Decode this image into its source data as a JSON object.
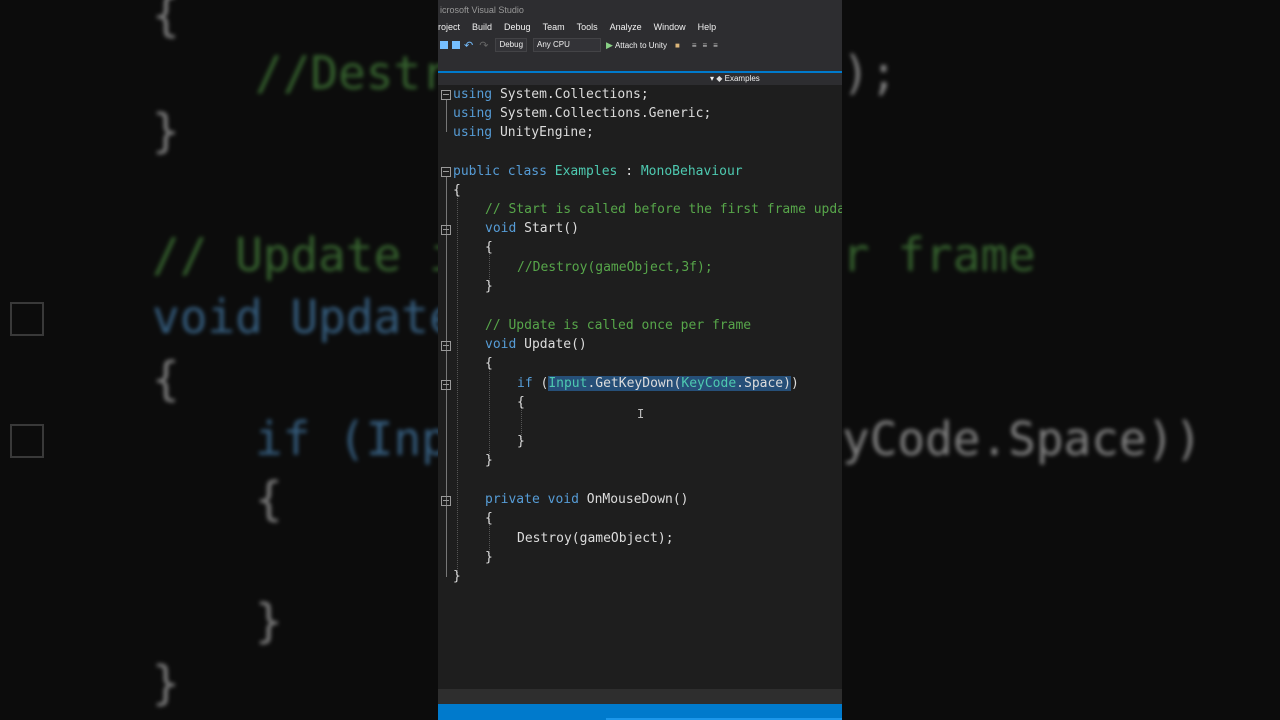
{
  "window": {
    "title": "icrosoft Visual Studio"
  },
  "menu": [
    "roject",
    "Build",
    "Debug",
    "Team",
    "Tools",
    "Analyze",
    "Window",
    "Help"
  ],
  "toolbar": {
    "config": "Debug",
    "platform": "Any CPU",
    "attach": "Attach to Unity"
  },
  "nav": {
    "member": "Examples"
  },
  "code": {
    "l1a": "using",
    "l1b": " System.Collections;",
    "l2a": "using",
    "l2b": " System.Collections.Generic;",
    "l3a": "using",
    "l3b": " UnityEngine;",
    "l5a": "public class",
    "l5b": " ",
    "l5c": "Examples",
    "l5d": " : ",
    "l5e": "MonoBehaviour",
    "l6": "{",
    "l7": "// Start is called before the first frame update",
    "l8a": "void",
    "l8b": " Start()",
    "l9": "{",
    "l10": "//Destroy(gameObject,3f);",
    "l11": "}",
    "l13": "// Update is called once per frame",
    "l14a": "void",
    "l14b": " Update()",
    "l15": "{",
    "l16a": "if",
    "l16b": " (",
    "l16c": "Input",
    "l16d": ".GetKeyDown(",
    "l16e": "KeyCode",
    "l16f": ".Space)",
    "l16g": ")",
    "l17": "{",
    "l19": "}",
    "l20": "}",
    "l22a": "private void",
    "l22b": " OnMouseDown()",
    "l23": "{",
    "l24": "Destroy(gameObject);",
    "l25": "}",
    "l26": "}"
  },
  "background": {
    "left": [
      "{",
      "//Destr",
      "}",
      "// Update i",
      "void Update",
      "{",
      "if (Inp",
      "{",
      "}",
      "}"
    ],
    "right": [
      ");",
      "r frame",
      "yCode.Space))"
    ]
  }
}
